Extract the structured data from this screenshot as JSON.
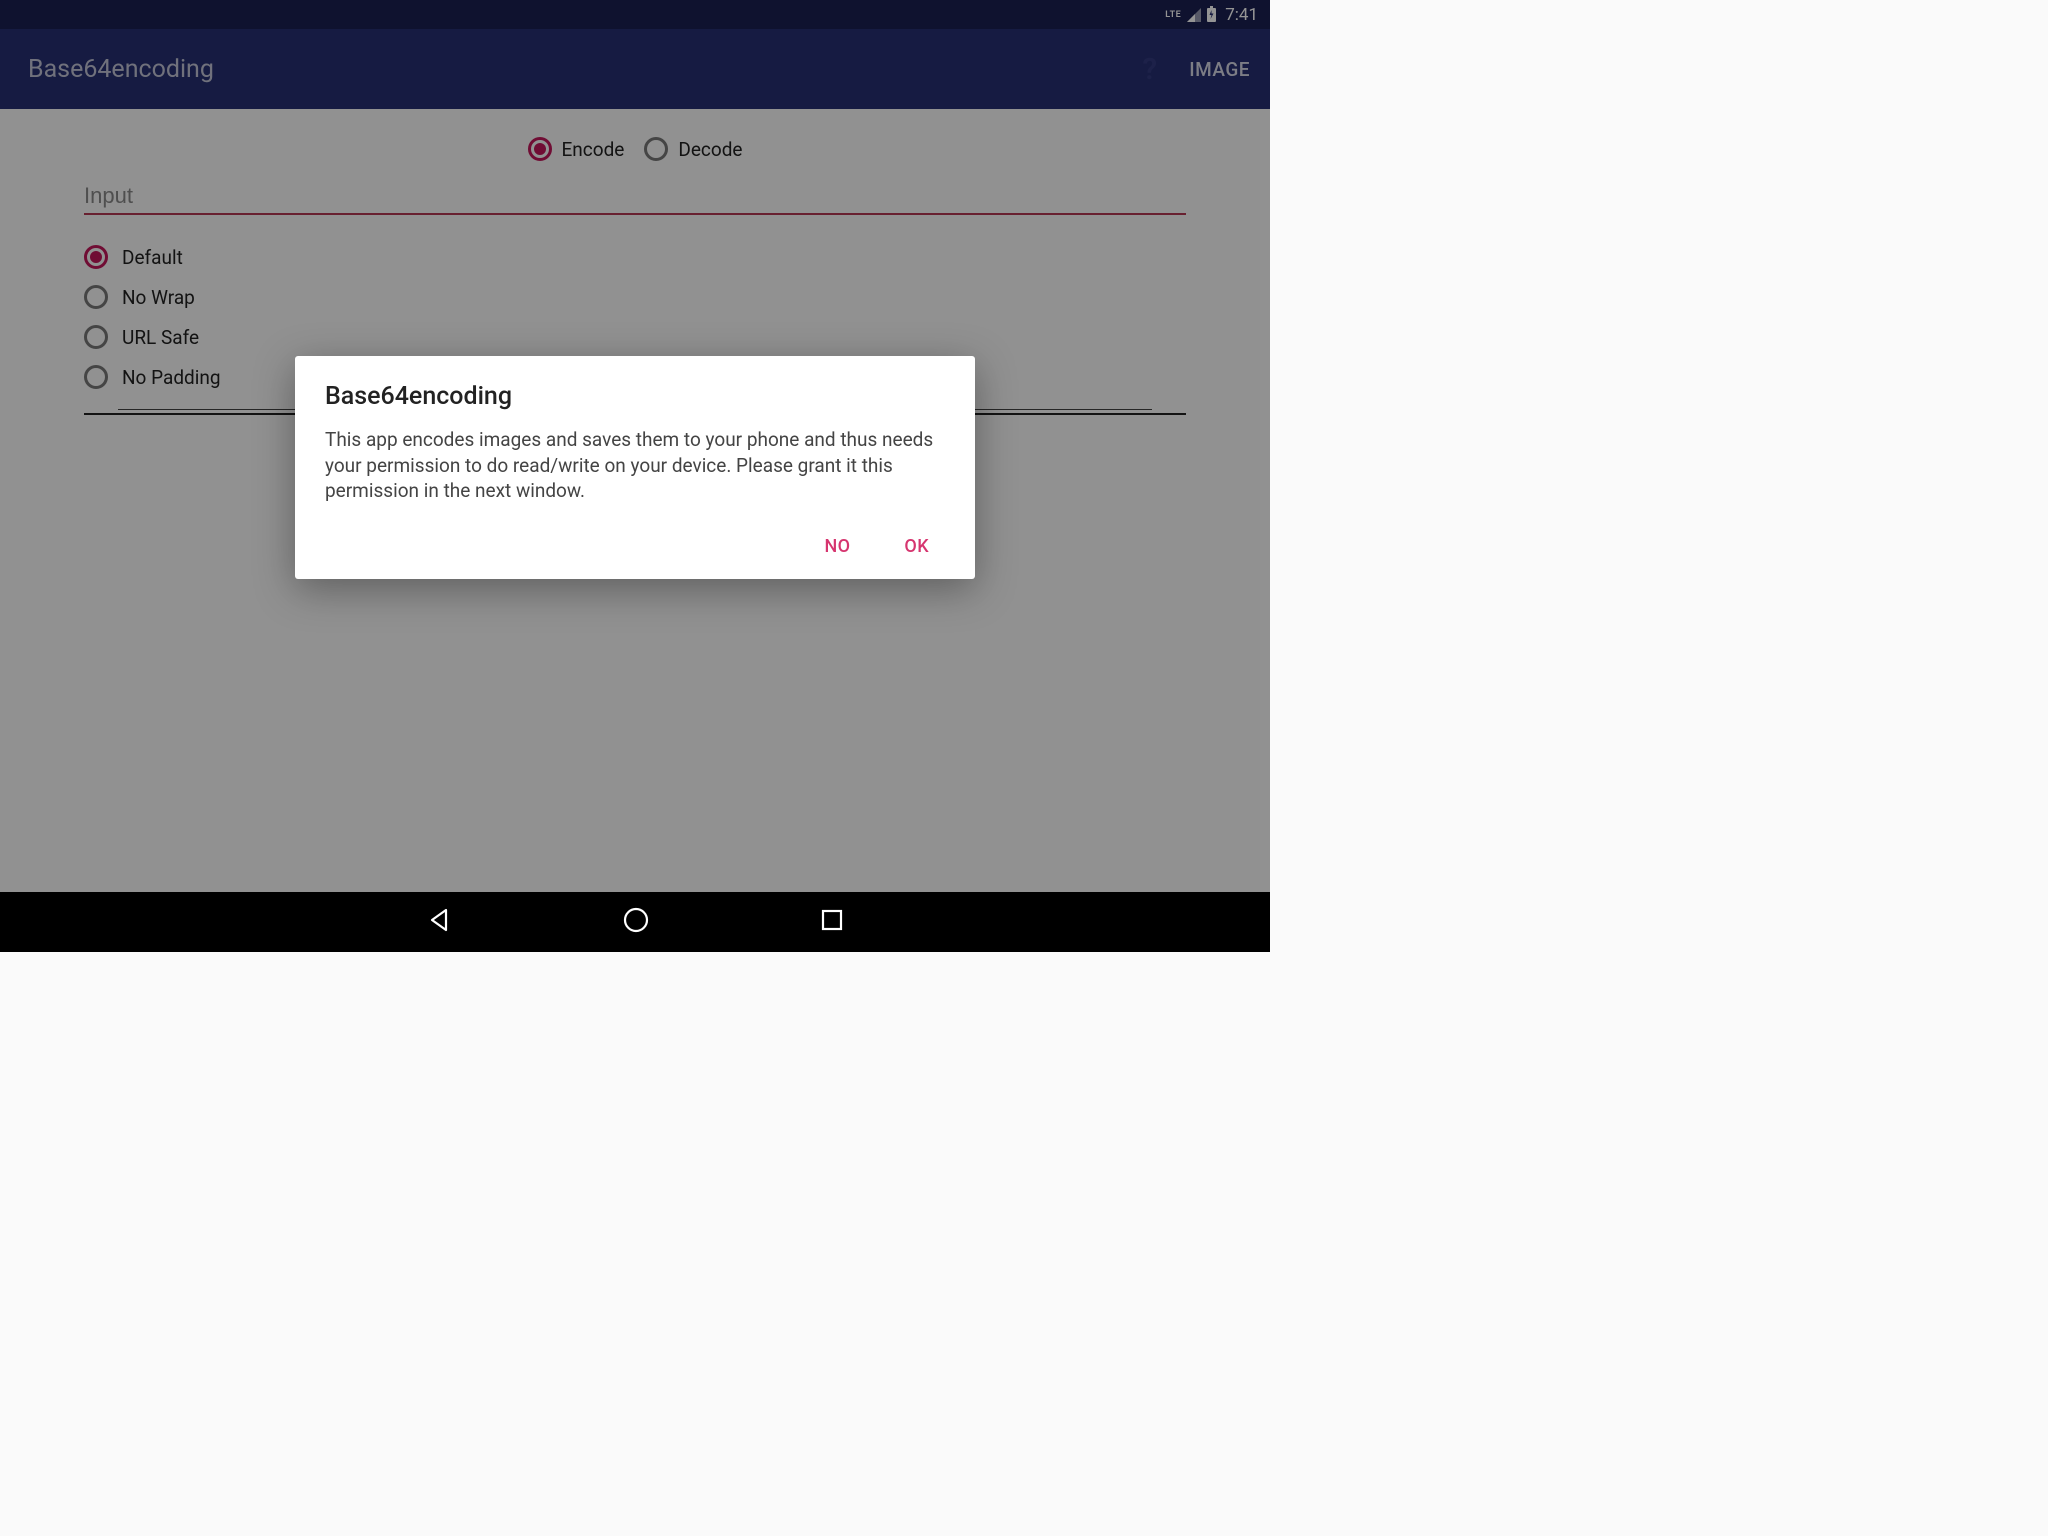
{
  "status": {
    "network": "LTE",
    "time": "7:41"
  },
  "appbar": {
    "title": "Base64encoding",
    "image_btn": "IMAGE"
  },
  "mode": {
    "encode_label": "Encode",
    "decode_label": "Decode",
    "selected": "encode"
  },
  "input": {
    "placeholder": "Input",
    "value": ""
  },
  "options": [
    {
      "label": "Default",
      "selected": true
    },
    {
      "label": "No Wrap",
      "selected": false
    },
    {
      "label": "URL Safe",
      "selected": false
    },
    {
      "label": "No Padding",
      "selected": false
    }
  ],
  "dialog": {
    "title": "Base64encoding",
    "message": "This app encodes images and saves them to your phone and thus needs your permission to do read/write on your device. Please grant it this permission in the next window.",
    "no": "NO",
    "ok": "OK"
  },
  "colors": {
    "accent": "#c2185b",
    "appbar": "#263072",
    "dialog_action": "#d6356f"
  }
}
